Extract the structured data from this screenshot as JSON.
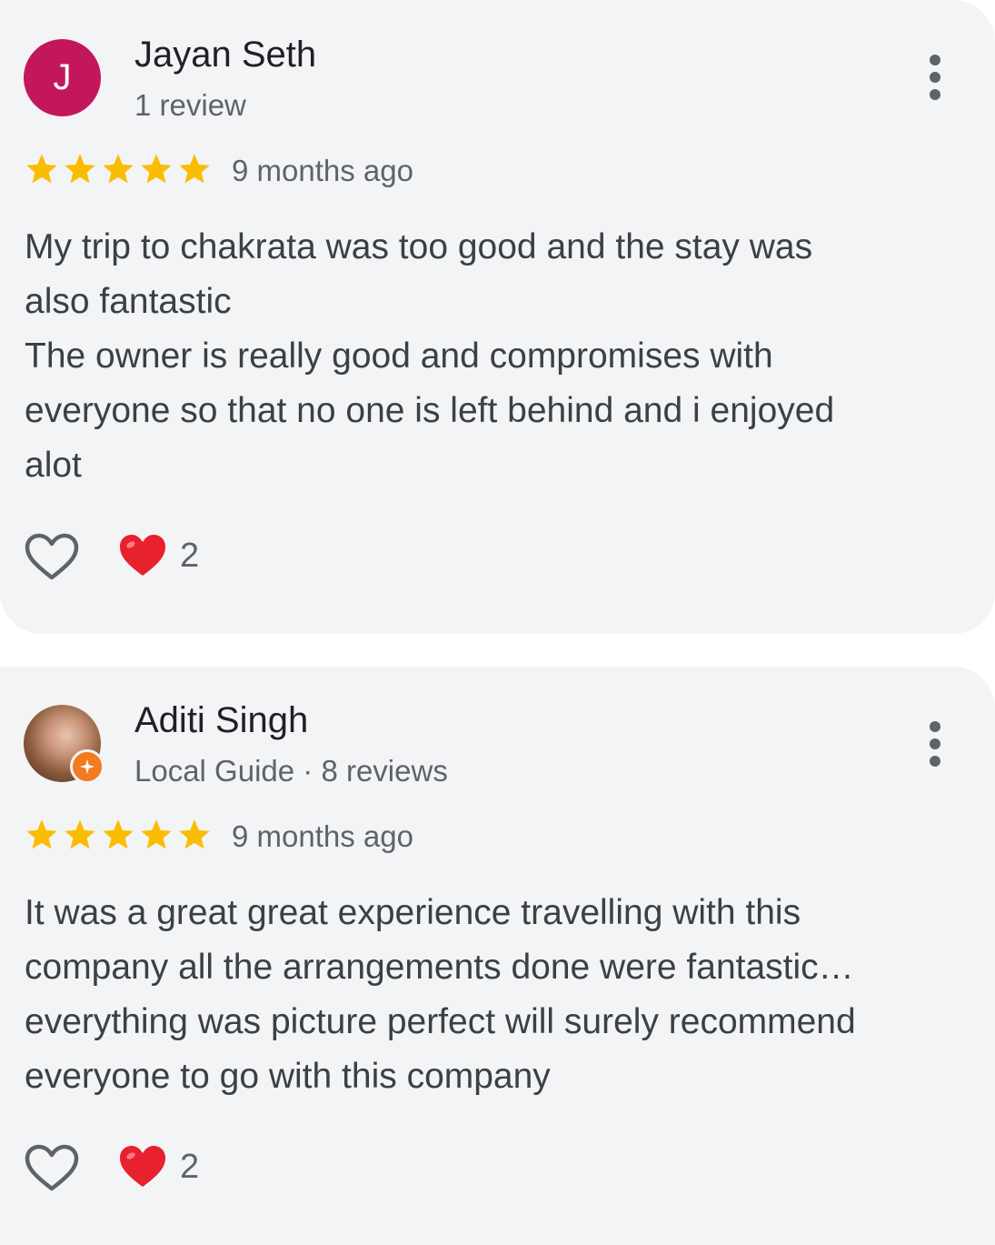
{
  "reviews": [
    {
      "name": "Jayan Seth",
      "avatar_letter": "J",
      "meta": "1 review",
      "rating": 5,
      "time": "9 months ago",
      "text": "My trip to chakrata was too good and the stay was\nalso fantastic\nThe owner is really good and compromises with\neveryone so that no one is left behind and i enjoyed\nalot",
      "reaction_count": "2"
    },
    {
      "name": "Aditi Singh",
      "meta": "Local Guide · 8 reviews",
      "rating": 5,
      "time": "9 months ago",
      "text": "It was a great great experience travelling with this\ncompany all the arrangements done were fantastic…\neverything was picture perfect will surely recommend\neveryone to go with this company",
      "reaction_count": "2"
    }
  ],
  "colors": {
    "star": "#fbbc04",
    "avatar_j": "#c2185b",
    "heart_red": "#e8212e",
    "local_guide_badge": "#f47a20"
  },
  "icons": [
    "more-vert-icon",
    "star-icon",
    "heart-outline-icon",
    "red-heart-emoji-icon",
    "local-guide-badge-icon"
  ]
}
